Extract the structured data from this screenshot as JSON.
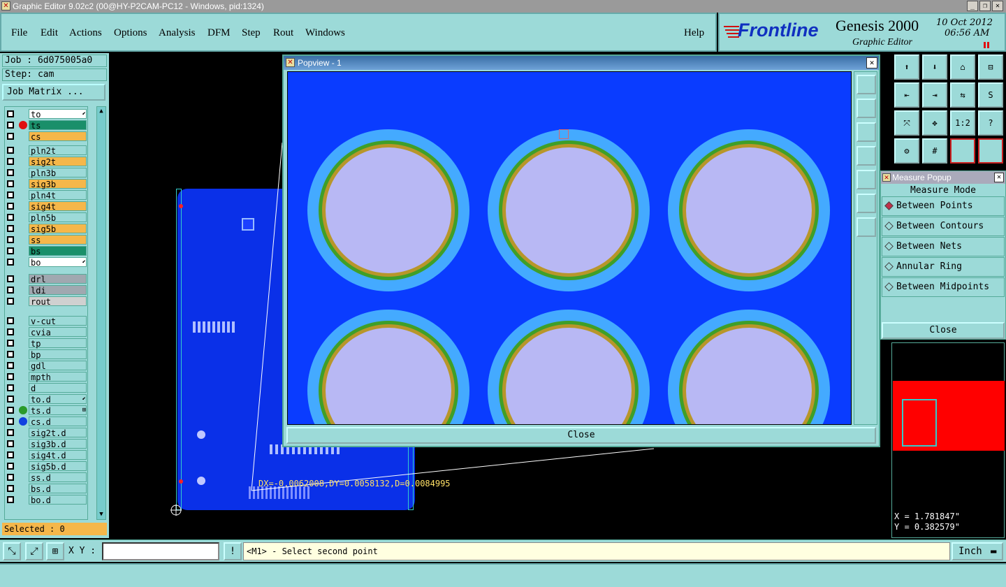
{
  "window": {
    "title": "Graphic Editor 9.02c2 (00@HY-P2CAM-PC12 - Windows, pid:1324)",
    "minimize": "_",
    "restore": "❐",
    "close": "✕"
  },
  "menu": {
    "items": [
      "File",
      "Edit",
      "Actions",
      "Options",
      "Analysis",
      "DFM",
      "Step",
      "Rout",
      "Windows"
    ],
    "help": "Help"
  },
  "brand": {
    "logo": "Frontline",
    "product": "Genesis 2000",
    "subtitle": "Graphic Editor",
    "date": "10 Oct 2012",
    "time": "06:56 AM"
  },
  "job": {
    "job_label": "Job : 6d075005a0",
    "step_label": "Step: cam",
    "matrix_button": "Job Matrix ..."
  },
  "layers": [
    {
      "name": "to",
      "color": "#ffffff",
      "dot": "",
      "flag": "⬋"
    },
    {
      "name": "ts",
      "color": "#1a8f6a",
      "dot": "#e01010",
      "flag": ""
    },
    {
      "name": "cs",
      "color": "#f5b74a",
      "dot": "",
      "flag": ""
    },
    {
      "name": "pln2t",
      "color": "#9cdad8",
      "dot": "",
      "flag": ""
    },
    {
      "name": "sig2t",
      "color": "#f5b74a",
      "dot": "",
      "flag": ""
    },
    {
      "name": "pln3b",
      "color": "#9cdad8",
      "dot": "",
      "flag": ""
    },
    {
      "name": "sig3b",
      "color": "#f5b74a",
      "dot": "",
      "flag": ""
    },
    {
      "name": "pln4t",
      "color": "#9cdad8",
      "dot": "",
      "flag": ""
    },
    {
      "name": "sig4t",
      "color": "#f5b74a",
      "dot": "",
      "flag": ""
    },
    {
      "name": "pln5b",
      "color": "#9cdad8",
      "dot": "",
      "flag": ""
    },
    {
      "name": "sig5b",
      "color": "#f5b74a",
      "dot": "",
      "flag": ""
    },
    {
      "name": "ss",
      "color": "#f5b74a",
      "dot": "",
      "flag": ""
    },
    {
      "name": "bs",
      "color": "#1a8f6a",
      "dot": "",
      "flag": ""
    },
    {
      "name": "bo",
      "color": "#ffffff",
      "dot": "",
      "flag": "⬋"
    },
    {
      "name": "drl",
      "color": "#a0a8b0",
      "dot": "",
      "flag": ""
    },
    {
      "name": "ldi",
      "color": "#a0a8b0",
      "dot": "",
      "flag": ""
    },
    {
      "name": "rout",
      "color": "#d0d0d0",
      "dot": "",
      "flag": ""
    },
    {
      "name": "v-cut",
      "color": "#9cdad8",
      "dot": "",
      "flag": ""
    },
    {
      "name": "cvia",
      "color": "#9cdad8",
      "dot": "",
      "flag": ""
    },
    {
      "name": "tp",
      "color": "#9cdad8",
      "dot": "",
      "flag": ""
    },
    {
      "name": "bp",
      "color": "#9cdad8",
      "dot": "",
      "flag": ""
    },
    {
      "name": "gdl",
      "color": "#9cdad8",
      "dot": "",
      "flag": ""
    },
    {
      "name": "mpth",
      "color": "#9cdad8",
      "dot": "",
      "flag": ""
    },
    {
      "name": "d",
      "color": "#9cdad8",
      "dot": "",
      "flag": ""
    },
    {
      "name": "to.d",
      "color": "#9cdad8",
      "dot": "",
      "flag": "⬋"
    },
    {
      "name": "ts.d",
      "color": "#9cdad8",
      "dot": "#2a9a2a",
      "flag": "⊞"
    },
    {
      "name": "cs.d",
      "color": "#9cdad8",
      "dot": "#1040e0",
      "flag": ""
    },
    {
      "name": "sig2t.d",
      "color": "#9cdad8",
      "dot": "",
      "flag": ""
    },
    {
      "name": "sig3b.d",
      "color": "#9cdad8",
      "dot": "",
      "flag": ""
    },
    {
      "name": "sig4t.d",
      "color": "#9cdad8",
      "dot": "",
      "flag": ""
    },
    {
      "name": "sig5b.d",
      "color": "#9cdad8",
      "dot": "",
      "flag": ""
    },
    {
      "name": "ss.d",
      "color": "#9cdad8",
      "dot": "",
      "flag": ""
    },
    {
      "name": "bs.d",
      "color": "#9cdad8",
      "dot": "",
      "flag": ""
    },
    {
      "name": "bo.d",
      "color": "#9cdad8",
      "dot": "",
      "flag": ""
    }
  ],
  "selected": "Selected : 0",
  "measurement": "DX=-0.0062008,DY=0.0058132,D=0.0084995",
  "popview": {
    "title": "Popview - 1",
    "close": "Close",
    "close_x": "✕"
  },
  "toolbar_icons": [
    "home-up",
    "home-down",
    "house",
    "window-split",
    "arrow-left",
    "arrow-right",
    "swap",
    "s-curve",
    "fit-all",
    "center",
    "ratio",
    "help",
    "tools",
    "grid",
    "board-red",
    "board-red2"
  ],
  "toolbar_labels": {
    "ratio": "1:2",
    "help": "?"
  },
  "measure_popup": {
    "title": "Measure Popup",
    "mode_label": "Measure Mode",
    "options": [
      "Between Points",
      "Between Contours",
      "Between Nets",
      "Annular Ring",
      "Between Midpoints"
    ],
    "selected": "Between Points",
    "close": "Close",
    "close_x": "✕"
  },
  "coords": {
    "x": "X = 1.781847\"",
    "y": "Y = 0.382579\""
  },
  "bottom": {
    "xy_label": "X Y :",
    "xy_value": "",
    "message": "<M1> - Select second point",
    "unit": "Inch",
    "excl": "!"
  },
  "colors": {
    "panel": "#9cdad8",
    "board_blue": "#0a3cff",
    "pad_outer": "#44aaff",
    "pad_inner": "#b8b8f4",
    "orange": "#f5b74a",
    "red": "#ff0000"
  }
}
